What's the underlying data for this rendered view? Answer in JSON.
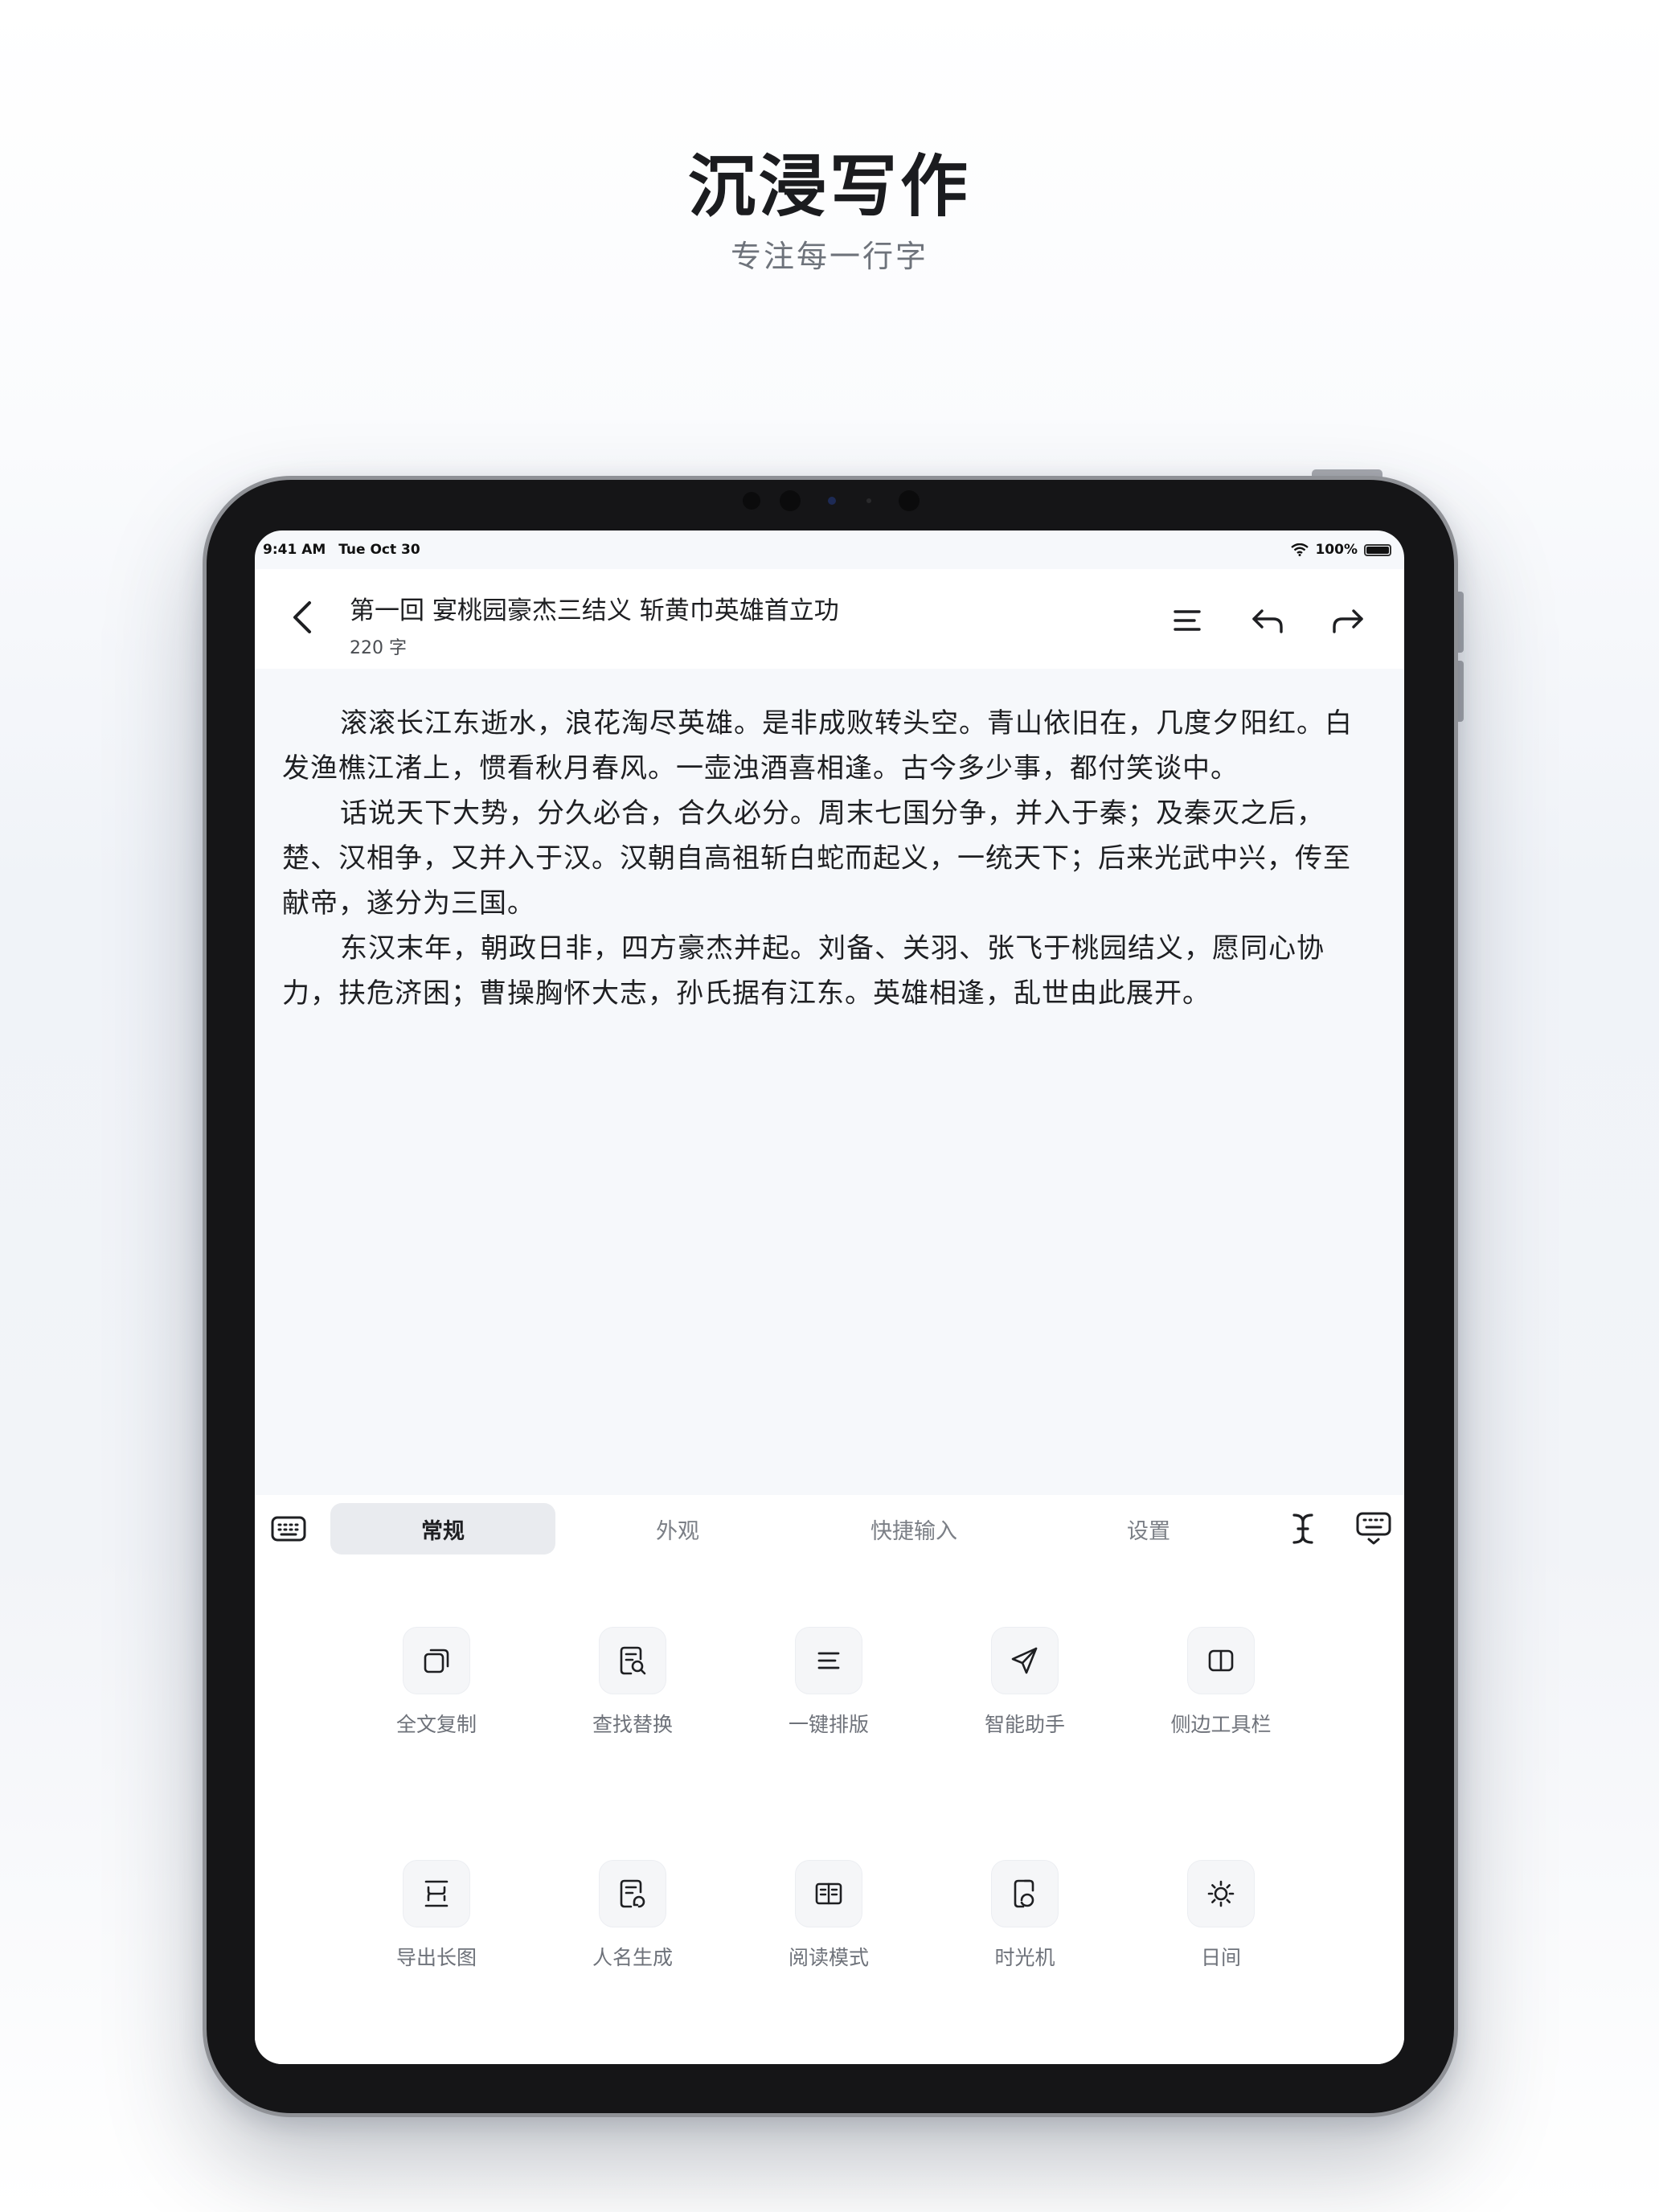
{
  "marketing": {
    "title": "沉浸写作",
    "subtitle": "专注每一行字"
  },
  "status_bar": {
    "time": "9:41 AM",
    "date": "Tue Oct 30",
    "battery": "100%"
  },
  "header": {
    "doc_title": "第一回 宴桃园豪杰三结义 斩黄巾英雄首立功",
    "word_count": "220 字"
  },
  "editor": {
    "paragraphs": [
      "滚滚长江东逝水，浪花淘尽英雄。是非成败转头空。青山依旧在，几度夕阳红。白发渔樵江渚上，惯看秋月春风。一壶浊酒喜相逢。古今多少事，都付笑谈中。",
      "话说天下大势，分久必合，合久必分。周末七国分争，并入于秦；及秦灭之后，楚、汉相争，又并入于汉。汉朝自高祖斩白蛇而起义，一统天下；后来光武中兴，传至献帝，遂分为三国。",
      "东汉末年，朝政日非，四方豪杰并起。刘备、关羽、张飞于桃园结义，愿同心协力，扶危济困；曹操胸怀大志，孙氏据有江东。英雄相逢，乱世由此展开。"
    ]
  },
  "toolbar": {
    "tabs": [
      {
        "label": "常规",
        "active": true
      },
      {
        "label": "外观",
        "active": false
      },
      {
        "label": "快捷输入",
        "active": false
      },
      {
        "label": "设置",
        "active": false
      }
    ]
  },
  "tools": [
    {
      "label": "全文复制",
      "icon": "copy-icon"
    },
    {
      "label": "查找替换",
      "icon": "find-replace-icon"
    },
    {
      "label": "一键排版",
      "icon": "format-icon"
    },
    {
      "label": "智能助手",
      "icon": "paper-plane-icon"
    },
    {
      "label": "侧边工具栏",
      "icon": "sidebar-icon"
    },
    {
      "label": "导出长图",
      "icon": "export-image-icon"
    },
    {
      "label": "人名生成",
      "icon": "name-generator-icon"
    },
    {
      "label": "阅读模式",
      "icon": "book-icon"
    },
    {
      "label": "时光机",
      "icon": "time-machine-icon"
    },
    {
      "label": "日间",
      "icon": "sun-icon"
    }
  ]
}
